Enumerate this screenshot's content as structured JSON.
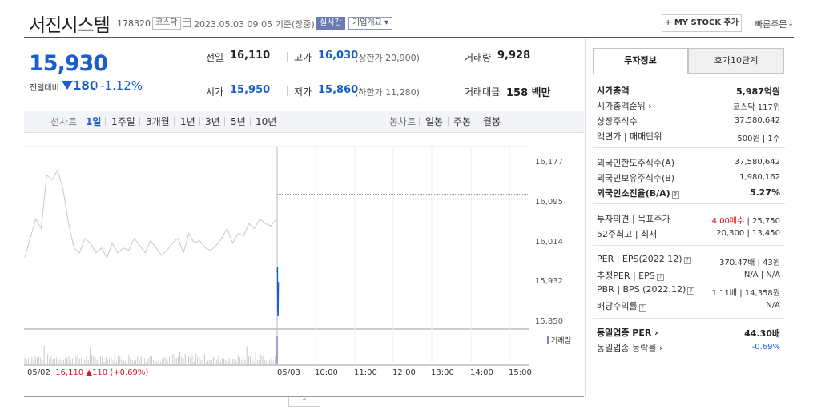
{
  "header": {
    "company_name": "서진시스템",
    "code": "178320",
    "market": "코스닥",
    "datetime": "2023.05.03 09:05",
    "basis": "기준(장중)",
    "realtime_label": "실시간",
    "company_overview": "기업개요 ▾",
    "mystock_label": "MY STOCK 추가",
    "quick_order": "빠른주문"
  },
  "summary": {
    "price": "15,930",
    "change_label": "전일대비",
    "change_value": "180",
    "change_rate": "-1.12%",
    "prev_close_label": "전일",
    "prev_close": "16,110",
    "high_label": "고가",
    "high": "16,030",
    "upper_limit": "(상한가 20,900)",
    "volume_label": "거래량",
    "volume": "9,928",
    "open_label": "시가",
    "open": "15,950",
    "low_label": "저가",
    "low": "15,860",
    "lower_limit": "(하한가 11,280)",
    "amount_label": "거래대금",
    "amount": "158 백만"
  },
  "chart_tabs": {
    "line_label": "선차트",
    "periods": [
      "1일",
      "1주일",
      "3개월",
      "1년",
      "3년",
      "5년",
      "10년"
    ],
    "candle_label": "봉차트",
    "candles": [
      "일봉",
      "주봉",
      "월봉"
    ]
  },
  "chart_data": {
    "type": "line",
    "y_ticks": [
      "16,177",
      "16,095",
      "16,014",
      "15,932",
      "15,850"
    ],
    "ylim": [
      15850,
      16177
    ],
    "x_ticks": [
      "05/02",
      "05/03",
      "10:00",
      "11:00",
      "12:00",
      "13:00",
      "14:00",
      "15:00"
    ],
    "prev_day": {
      "date": "05/02",
      "close": "16,110",
      "change": "▲110",
      "rate": "(+0.69%)",
      "series": [
        15980,
        16020,
        16060,
        16040,
        16150,
        16140,
        16160,
        16120,
        16050,
        16000,
        15990,
        16020,
        16010,
        15990,
        16000,
        15980,
        16010,
        15990,
        16000,
        15995,
        16020,
        16005,
        15990,
        16015,
        16000,
        15985,
        15995,
        16010,
        16020,
        15990,
        16030,
        16010,
        16015,
        16000,
        15995,
        16005,
        16020,
        16040,
        16010,
        16030,
        16025,
        16050,
        16040,
        16060,
        16050,
        16045,
        16060
      ]
    },
    "today": {
      "date": "05/03",
      "series": [
        15950,
        15960,
        15870,
        15860,
        15930
      ]
    },
    "prev_close_line": 16110,
    "volume_legend": "거래량"
  },
  "invest": {
    "tab_active": "투자정보",
    "tab_other": "호가10단계",
    "rows1": [
      {
        "label": "시가총액",
        "value": "5,987억원",
        "bold": true
      },
      {
        "label": "시가총액순위 ›",
        "value": "코스닥 117위"
      },
      {
        "label": "상장주식수",
        "value": "37,580,642"
      },
      {
        "label": "액면가 | 매매단위",
        "value": "500원 | 1주"
      }
    ],
    "rows2": [
      {
        "label": "외국인한도주식수(A)",
        "value": "37,580,642"
      },
      {
        "label": "외국인보유주식수(B)",
        "value": "1,980,162"
      },
      {
        "label": "외국인소진율(B/A)",
        "value": "5.27%",
        "bold": true
      }
    ],
    "opinion_label": "투자의견 | 목표주가",
    "opinion_value": "4.00매수",
    "target_value": "| 25,750",
    "w52_label": "52주최고 | 최저",
    "w52_value": "20,300 | 13,450",
    "per_label": "PER | EPS(2022.12)",
    "per_value": "370.47배 | 43원",
    "est_label": "추정PER | EPS",
    "est_value": "N/A | N/A",
    "pbr_label": "PBR | BPS (2022.12)",
    "pbr_value": "1.11배 | 14,358원",
    "div_label": "배당수익률",
    "div_value": "N/A",
    "sector_per_label": "동일업종 PER ›",
    "sector_per_value": "44.30배",
    "sector_rate_label": "동일업종 등락률 ›",
    "sector_rate_value": "-0.69%"
  },
  "colors": {
    "up": "#dd1122",
    "down": "#1a5fc9",
    "accent": "#6a7bb3"
  }
}
